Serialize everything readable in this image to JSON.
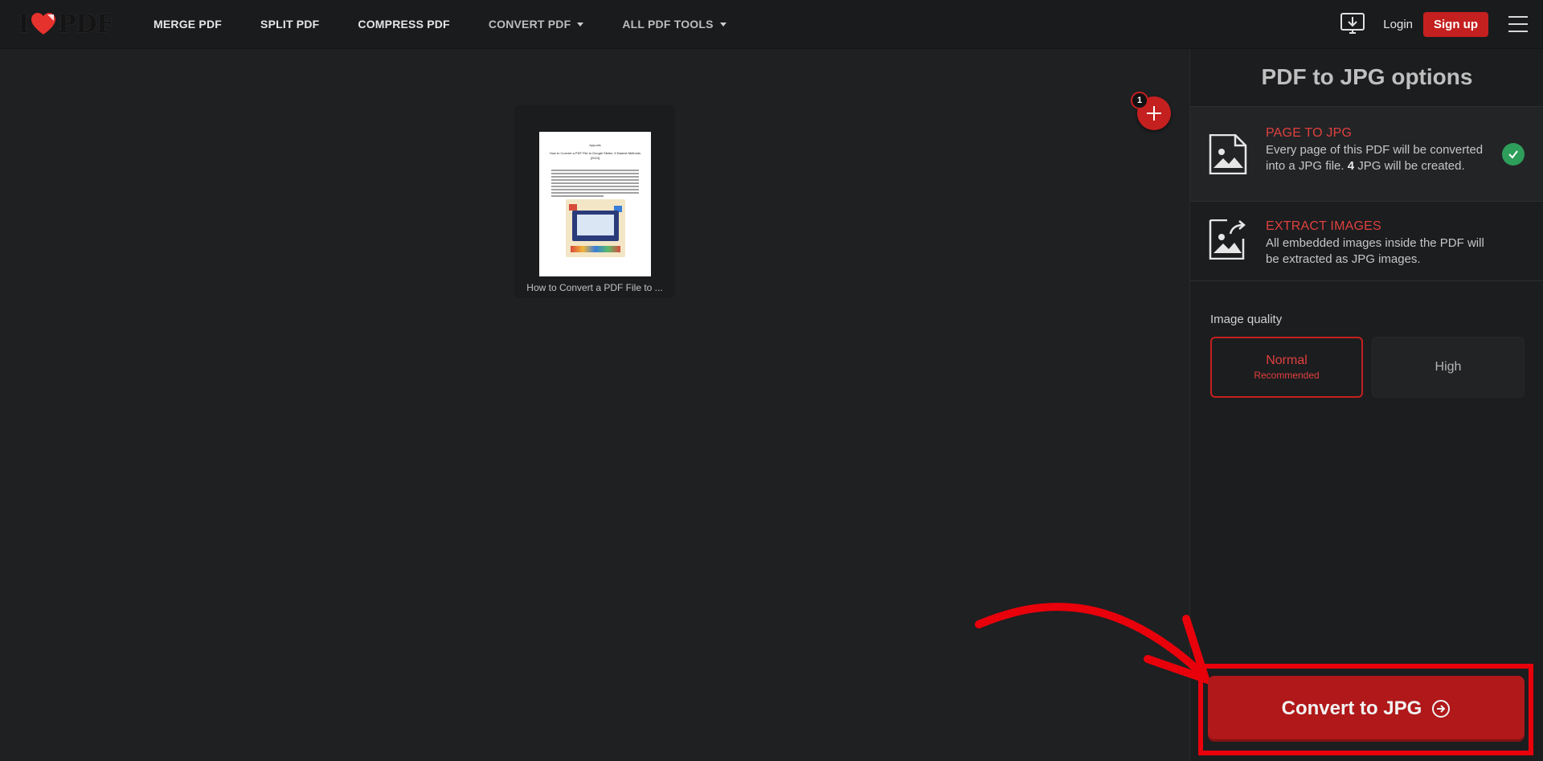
{
  "header": {
    "logo_left": "I",
    "logo_right": "PDF",
    "nav": [
      {
        "label": "MERGE PDF",
        "dropdown": false
      },
      {
        "label": "SPLIT PDF",
        "dropdown": false
      },
      {
        "label": "COMPRESS PDF",
        "dropdown": false
      },
      {
        "label": "CONVERT PDF",
        "dropdown": true
      },
      {
        "label": "ALL PDF TOOLS",
        "dropdown": true
      }
    ],
    "login": "Login",
    "signup": "Sign up",
    "icons": [
      "desktop-download-icon",
      "hamburger-menu-icon"
    ]
  },
  "workspace": {
    "file": {
      "name": "How to Convert a PDF File to ...",
      "thumb_header": "Appuals",
      "thumb_title": "How to Convert a PDF File to Google Slides: 3 Easiest Methods [2024]"
    },
    "file_count": "1"
  },
  "sidebar": {
    "title": "PDF to JPG options",
    "options": [
      {
        "title": "PAGE TO JPG",
        "desc_a": "Every page of this PDF will be converted into a JPG file.",
        "desc_count": "4",
        "desc_b": "JPG will be created.",
        "selected": true
      },
      {
        "title": "EXTRACT IMAGES",
        "desc": "All embedded images inside the PDF will be extracted as JPG images.",
        "selected": false
      }
    ],
    "image_quality": {
      "label": "Image quality",
      "normal": "Normal",
      "normal_sub": "Recommended",
      "high": "High",
      "selected": "Normal"
    },
    "convert_button": "Convert to JPG"
  },
  "colors": {
    "accent": "#c4201f",
    "annotation": "#e8000b",
    "success": "#2e9e5b",
    "background": "#1e2022"
  }
}
